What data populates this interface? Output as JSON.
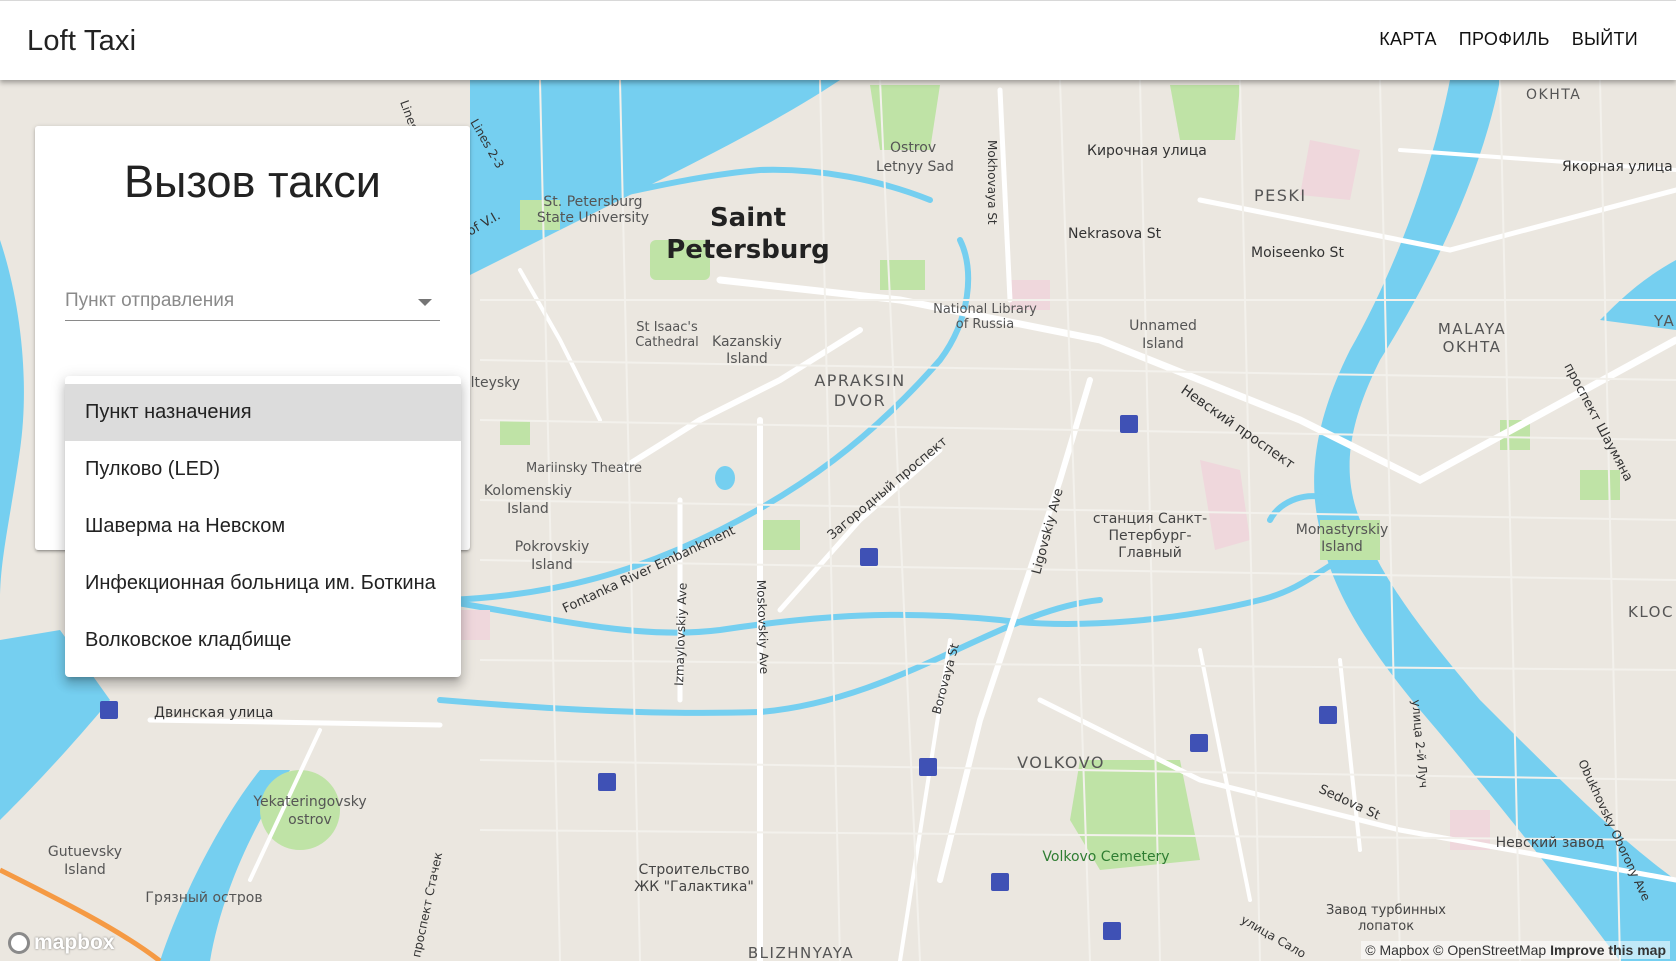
{
  "app": {
    "title": "Loft Taxi"
  },
  "nav": {
    "items": [
      "КАРТА",
      "ПРОФИЛЬ",
      "ВЫЙТИ"
    ]
  },
  "order_form": {
    "title": "Вызов такси",
    "from_placeholder": "Пункт отправления",
    "menu_items": [
      "Пункт назначения",
      "Пулково (LED)",
      "Шаверма на Невском",
      "Инфекционная больница им. Боткина",
      "Волковское кладбище"
    ],
    "highlighted_index": 0
  },
  "map": {
    "labels": {
      "city": [
        "Saint",
        "Petersburg"
      ],
      "okhta": "OKHTA",
      "kirochnaya": "Кирочная улица",
      "yakornaya": "Якорная улица",
      "ostrov1": "Ostrov",
      "ostrov2": "Letnyy Sad",
      "mokhovaya": "Mokhovaya St",
      "peski": "PESKI",
      "nekrasova": "Nekrasova St",
      "moiseenko": "Moiseenko St",
      "lines": "Lines",
      "lines23": "Lines 2-3",
      "spbu1": "St. Petersburg",
      "spbu2": "State University",
      "ofv": "of V.I.",
      "isaac1": "St Isaac's",
      "isaac2": "Cathedral",
      "kaz1": "Kazanskiy",
      "kaz2": "Island",
      "nlr1": "National Library",
      "nlr2": "of Russia",
      "unnamed1": "Unnamed",
      "unnamed2": "Island",
      "malaya1": "MALAYA",
      "malaya2": "OKHTA",
      "ya": "YA",
      "apraksin1": "APRAKSIN",
      "apraksin2": "DVOR",
      "nevsky": "Невский проспект",
      "shaumyana": "проспект Шаумяна",
      "alteysky": "alteysky",
      "mariinsky": "Mariinsky Theatre",
      "zagorodny": "Загородный проспект",
      "ligovsky": "Ligovskiy Ave",
      "station1": "станция Санкт-",
      "station2": "Петербург-",
      "station3": "Главный",
      "kolom1": "Kolomenskiy",
      "kolom2": "Island",
      "monast1": "Monastyrskiy",
      "monast2": "Island",
      "pokrov1": "Pokrovskiy",
      "pokrov2": "Island",
      "fontanka": "Fontanka River Embankment",
      "izmailov": "Izmaylovskiy Ave",
      "moskovsky": "Moskovskiy Ave",
      "kloch": "KLOC",
      "borovaya": "Borovaya St",
      "dvinskaya": "Двинская улица",
      "volkovo": "VOLKOVO",
      "luch": "улица 2-й Луч",
      "obukh": "Obukhovsky Oborony Ave",
      "sedova": "Sedova St",
      "yekat1": "Yekateringovsky",
      "yekat2": "ostrov",
      "guteu1": "Gutuevsky",
      "guteu2": "Island",
      "stroy1": "Строительство",
      "stroy2": "ЖК \"Галактика\"",
      "volkcem": "Volkovo Cemetery",
      "nevzavod": "Невский завод",
      "gryaz": "Грязный остров",
      "zavod1": "Завод турбинных",
      "zavod2": "лопаток",
      "stachek": "проспект Стачек",
      "salo": "улица Сало",
      "bliz": "BLIZHNYAYA"
    },
    "attribution": "© Mapbox © OpenStreetMap",
    "improve": "Improve this map",
    "logo": "mapbox"
  }
}
